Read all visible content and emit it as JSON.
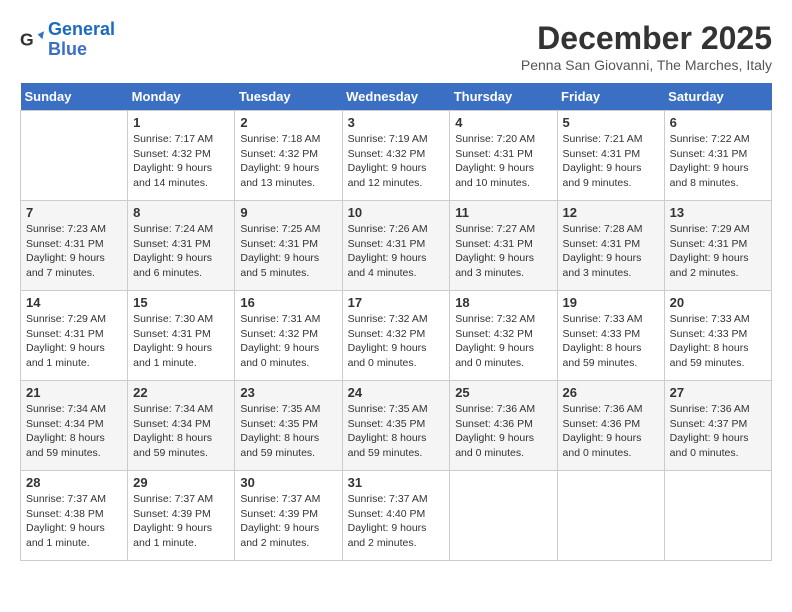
{
  "logo": {
    "line1": "General",
    "line2": "Blue"
  },
  "title": "December 2025",
  "subtitle": "Penna San Giovanni, The Marches, Italy",
  "weekdays": [
    "Sunday",
    "Monday",
    "Tuesday",
    "Wednesday",
    "Thursday",
    "Friday",
    "Saturday"
  ],
  "weeks": [
    [
      {
        "day": "",
        "info": ""
      },
      {
        "day": "1",
        "info": "Sunrise: 7:17 AM\nSunset: 4:32 PM\nDaylight: 9 hours\nand 14 minutes."
      },
      {
        "day": "2",
        "info": "Sunrise: 7:18 AM\nSunset: 4:32 PM\nDaylight: 9 hours\nand 13 minutes."
      },
      {
        "day": "3",
        "info": "Sunrise: 7:19 AM\nSunset: 4:32 PM\nDaylight: 9 hours\nand 12 minutes."
      },
      {
        "day": "4",
        "info": "Sunrise: 7:20 AM\nSunset: 4:31 PM\nDaylight: 9 hours\nand 10 minutes."
      },
      {
        "day": "5",
        "info": "Sunrise: 7:21 AM\nSunset: 4:31 PM\nDaylight: 9 hours\nand 9 minutes."
      },
      {
        "day": "6",
        "info": "Sunrise: 7:22 AM\nSunset: 4:31 PM\nDaylight: 9 hours\nand 8 minutes."
      }
    ],
    [
      {
        "day": "7",
        "info": "Sunrise: 7:23 AM\nSunset: 4:31 PM\nDaylight: 9 hours\nand 7 minutes."
      },
      {
        "day": "8",
        "info": "Sunrise: 7:24 AM\nSunset: 4:31 PM\nDaylight: 9 hours\nand 6 minutes."
      },
      {
        "day": "9",
        "info": "Sunrise: 7:25 AM\nSunset: 4:31 PM\nDaylight: 9 hours\nand 5 minutes."
      },
      {
        "day": "10",
        "info": "Sunrise: 7:26 AM\nSunset: 4:31 PM\nDaylight: 9 hours\nand 4 minutes."
      },
      {
        "day": "11",
        "info": "Sunrise: 7:27 AM\nSunset: 4:31 PM\nDaylight: 9 hours\nand 3 minutes."
      },
      {
        "day": "12",
        "info": "Sunrise: 7:28 AM\nSunset: 4:31 PM\nDaylight: 9 hours\nand 3 minutes."
      },
      {
        "day": "13",
        "info": "Sunrise: 7:29 AM\nSunset: 4:31 PM\nDaylight: 9 hours\nand 2 minutes."
      }
    ],
    [
      {
        "day": "14",
        "info": "Sunrise: 7:29 AM\nSunset: 4:31 PM\nDaylight: 9 hours\nand 1 minute."
      },
      {
        "day": "15",
        "info": "Sunrise: 7:30 AM\nSunset: 4:31 PM\nDaylight: 9 hours\nand 1 minute."
      },
      {
        "day": "16",
        "info": "Sunrise: 7:31 AM\nSunset: 4:32 PM\nDaylight: 9 hours\nand 0 minutes."
      },
      {
        "day": "17",
        "info": "Sunrise: 7:32 AM\nSunset: 4:32 PM\nDaylight: 9 hours\nand 0 minutes."
      },
      {
        "day": "18",
        "info": "Sunrise: 7:32 AM\nSunset: 4:32 PM\nDaylight: 9 hours\nand 0 minutes."
      },
      {
        "day": "19",
        "info": "Sunrise: 7:33 AM\nSunset: 4:33 PM\nDaylight: 8 hours\nand 59 minutes."
      },
      {
        "day": "20",
        "info": "Sunrise: 7:33 AM\nSunset: 4:33 PM\nDaylight: 8 hours\nand 59 minutes."
      }
    ],
    [
      {
        "day": "21",
        "info": "Sunrise: 7:34 AM\nSunset: 4:34 PM\nDaylight: 8 hours\nand 59 minutes."
      },
      {
        "day": "22",
        "info": "Sunrise: 7:34 AM\nSunset: 4:34 PM\nDaylight: 8 hours\nand 59 minutes."
      },
      {
        "day": "23",
        "info": "Sunrise: 7:35 AM\nSunset: 4:35 PM\nDaylight: 8 hours\nand 59 minutes."
      },
      {
        "day": "24",
        "info": "Sunrise: 7:35 AM\nSunset: 4:35 PM\nDaylight: 8 hours\nand 59 minutes."
      },
      {
        "day": "25",
        "info": "Sunrise: 7:36 AM\nSunset: 4:36 PM\nDaylight: 9 hours\nand 0 minutes."
      },
      {
        "day": "26",
        "info": "Sunrise: 7:36 AM\nSunset: 4:36 PM\nDaylight: 9 hours\nand 0 minutes."
      },
      {
        "day": "27",
        "info": "Sunrise: 7:36 AM\nSunset: 4:37 PM\nDaylight: 9 hours\nand 0 minutes."
      }
    ],
    [
      {
        "day": "28",
        "info": "Sunrise: 7:37 AM\nSunset: 4:38 PM\nDaylight: 9 hours\nand 1 minute."
      },
      {
        "day": "29",
        "info": "Sunrise: 7:37 AM\nSunset: 4:39 PM\nDaylight: 9 hours\nand 1 minute."
      },
      {
        "day": "30",
        "info": "Sunrise: 7:37 AM\nSunset: 4:39 PM\nDaylight: 9 hours\nand 2 minutes."
      },
      {
        "day": "31",
        "info": "Sunrise: 7:37 AM\nSunset: 4:40 PM\nDaylight: 9 hours\nand 2 minutes."
      },
      {
        "day": "",
        "info": ""
      },
      {
        "day": "",
        "info": ""
      },
      {
        "day": "",
        "info": ""
      }
    ]
  ]
}
